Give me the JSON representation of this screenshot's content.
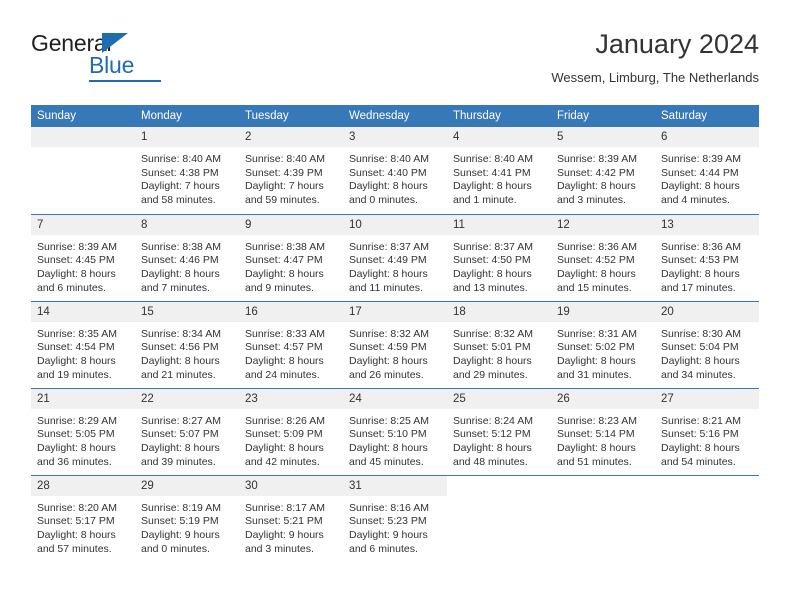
{
  "brand": {
    "name_top": "General",
    "name_bottom": "Blue",
    "accent_color": "#1f6cb0"
  },
  "header": {
    "title": "January 2024",
    "subtitle": "Wessem, Limburg, The Netherlands"
  },
  "theme": {
    "header_bg": "#3678b8",
    "daynum_bg": "#f0f0f0",
    "text_color": "#333333"
  },
  "weekday_headers": [
    "Sunday",
    "Monday",
    "Tuesday",
    "Wednesday",
    "Thursday",
    "Friday",
    "Saturday"
  ],
  "weeks": [
    [
      {
        "day": "",
        "empty": true,
        "sunrise": "",
        "sunset": "",
        "daylight_1": "",
        "daylight_2": ""
      },
      {
        "day": "1",
        "sunrise": "Sunrise: 8:40 AM",
        "sunset": "Sunset: 4:38 PM",
        "daylight_1": "Daylight: 7 hours",
        "daylight_2": "and 58 minutes."
      },
      {
        "day": "2",
        "sunrise": "Sunrise: 8:40 AM",
        "sunset": "Sunset: 4:39 PM",
        "daylight_1": "Daylight: 7 hours",
        "daylight_2": "and 59 minutes."
      },
      {
        "day": "3",
        "sunrise": "Sunrise: 8:40 AM",
        "sunset": "Sunset: 4:40 PM",
        "daylight_1": "Daylight: 8 hours",
        "daylight_2": "and 0 minutes."
      },
      {
        "day": "4",
        "sunrise": "Sunrise: 8:40 AM",
        "sunset": "Sunset: 4:41 PM",
        "daylight_1": "Daylight: 8 hours",
        "daylight_2": "and 1 minute."
      },
      {
        "day": "5",
        "sunrise": "Sunrise: 8:39 AM",
        "sunset": "Sunset: 4:42 PM",
        "daylight_1": "Daylight: 8 hours",
        "daylight_2": "and 3 minutes."
      },
      {
        "day": "6",
        "sunrise": "Sunrise: 8:39 AM",
        "sunset": "Sunset: 4:44 PM",
        "daylight_1": "Daylight: 8 hours",
        "daylight_2": "and 4 minutes."
      }
    ],
    [
      {
        "day": "7",
        "sunrise": "Sunrise: 8:39 AM",
        "sunset": "Sunset: 4:45 PM",
        "daylight_1": "Daylight: 8 hours",
        "daylight_2": "and 6 minutes."
      },
      {
        "day": "8",
        "sunrise": "Sunrise: 8:38 AM",
        "sunset": "Sunset: 4:46 PM",
        "daylight_1": "Daylight: 8 hours",
        "daylight_2": "and 7 minutes."
      },
      {
        "day": "9",
        "sunrise": "Sunrise: 8:38 AM",
        "sunset": "Sunset: 4:47 PM",
        "daylight_1": "Daylight: 8 hours",
        "daylight_2": "and 9 minutes."
      },
      {
        "day": "10",
        "sunrise": "Sunrise: 8:37 AM",
        "sunset": "Sunset: 4:49 PM",
        "daylight_1": "Daylight: 8 hours",
        "daylight_2": "and 11 minutes."
      },
      {
        "day": "11",
        "sunrise": "Sunrise: 8:37 AM",
        "sunset": "Sunset: 4:50 PM",
        "daylight_1": "Daylight: 8 hours",
        "daylight_2": "and 13 minutes."
      },
      {
        "day": "12",
        "sunrise": "Sunrise: 8:36 AM",
        "sunset": "Sunset: 4:52 PM",
        "daylight_1": "Daylight: 8 hours",
        "daylight_2": "and 15 minutes."
      },
      {
        "day": "13",
        "sunrise": "Sunrise: 8:36 AM",
        "sunset": "Sunset: 4:53 PM",
        "daylight_1": "Daylight: 8 hours",
        "daylight_2": "and 17 minutes."
      }
    ],
    [
      {
        "day": "14",
        "sunrise": "Sunrise: 8:35 AM",
        "sunset": "Sunset: 4:54 PM",
        "daylight_1": "Daylight: 8 hours",
        "daylight_2": "and 19 minutes."
      },
      {
        "day": "15",
        "sunrise": "Sunrise: 8:34 AM",
        "sunset": "Sunset: 4:56 PM",
        "daylight_1": "Daylight: 8 hours",
        "daylight_2": "and 21 minutes."
      },
      {
        "day": "16",
        "sunrise": "Sunrise: 8:33 AM",
        "sunset": "Sunset: 4:57 PM",
        "daylight_1": "Daylight: 8 hours",
        "daylight_2": "and 24 minutes."
      },
      {
        "day": "17",
        "sunrise": "Sunrise: 8:32 AM",
        "sunset": "Sunset: 4:59 PM",
        "daylight_1": "Daylight: 8 hours",
        "daylight_2": "and 26 minutes."
      },
      {
        "day": "18",
        "sunrise": "Sunrise: 8:32 AM",
        "sunset": "Sunset: 5:01 PM",
        "daylight_1": "Daylight: 8 hours",
        "daylight_2": "and 29 minutes."
      },
      {
        "day": "19",
        "sunrise": "Sunrise: 8:31 AM",
        "sunset": "Sunset: 5:02 PM",
        "daylight_1": "Daylight: 8 hours",
        "daylight_2": "and 31 minutes."
      },
      {
        "day": "20",
        "sunrise": "Sunrise: 8:30 AM",
        "sunset": "Sunset: 5:04 PM",
        "daylight_1": "Daylight: 8 hours",
        "daylight_2": "and 34 minutes."
      }
    ],
    [
      {
        "day": "21",
        "sunrise": "Sunrise: 8:29 AM",
        "sunset": "Sunset: 5:05 PM",
        "daylight_1": "Daylight: 8 hours",
        "daylight_2": "and 36 minutes."
      },
      {
        "day": "22",
        "sunrise": "Sunrise: 8:27 AM",
        "sunset": "Sunset: 5:07 PM",
        "daylight_1": "Daylight: 8 hours",
        "daylight_2": "and 39 minutes."
      },
      {
        "day": "23",
        "sunrise": "Sunrise: 8:26 AM",
        "sunset": "Sunset: 5:09 PM",
        "daylight_1": "Daylight: 8 hours",
        "daylight_2": "and 42 minutes."
      },
      {
        "day": "24",
        "sunrise": "Sunrise: 8:25 AM",
        "sunset": "Sunset: 5:10 PM",
        "daylight_1": "Daylight: 8 hours",
        "daylight_2": "and 45 minutes."
      },
      {
        "day": "25",
        "sunrise": "Sunrise: 8:24 AM",
        "sunset": "Sunset: 5:12 PM",
        "daylight_1": "Daylight: 8 hours",
        "daylight_2": "and 48 minutes."
      },
      {
        "day": "26",
        "sunrise": "Sunrise: 8:23 AM",
        "sunset": "Sunset: 5:14 PM",
        "daylight_1": "Daylight: 8 hours",
        "daylight_2": "and 51 minutes."
      },
      {
        "day": "27",
        "sunrise": "Sunrise: 8:21 AM",
        "sunset": "Sunset: 5:16 PM",
        "daylight_1": "Daylight: 8 hours",
        "daylight_2": "and 54 minutes."
      }
    ],
    [
      {
        "day": "28",
        "sunrise": "Sunrise: 8:20 AM",
        "sunset": "Sunset: 5:17 PM",
        "daylight_1": "Daylight: 8 hours",
        "daylight_2": "and 57 minutes."
      },
      {
        "day": "29",
        "sunrise": "Sunrise: 8:19 AM",
        "sunset": "Sunset: 5:19 PM",
        "daylight_1": "Daylight: 9 hours",
        "daylight_2": "and 0 minutes."
      },
      {
        "day": "30",
        "sunrise": "Sunrise: 8:17 AM",
        "sunset": "Sunset: 5:21 PM",
        "daylight_1": "Daylight: 9 hours",
        "daylight_2": "and 3 minutes."
      },
      {
        "day": "31",
        "sunrise": "Sunrise: 8:16 AM",
        "sunset": "Sunset: 5:23 PM",
        "daylight_1": "Daylight: 9 hours",
        "daylight_2": "and 6 minutes."
      },
      {
        "day": "",
        "blank": true,
        "sunrise": "",
        "sunset": "",
        "daylight_1": "",
        "daylight_2": ""
      },
      {
        "day": "",
        "blank": true,
        "sunrise": "",
        "sunset": "",
        "daylight_1": "",
        "daylight_2": ""
      },
      {
        "day": "",
        "blank": true,
        "sunrise": "",
        "sunset": "",
        "daylight_1": "",
        "daylight_2": ""
      }
    ]
  ]
}
